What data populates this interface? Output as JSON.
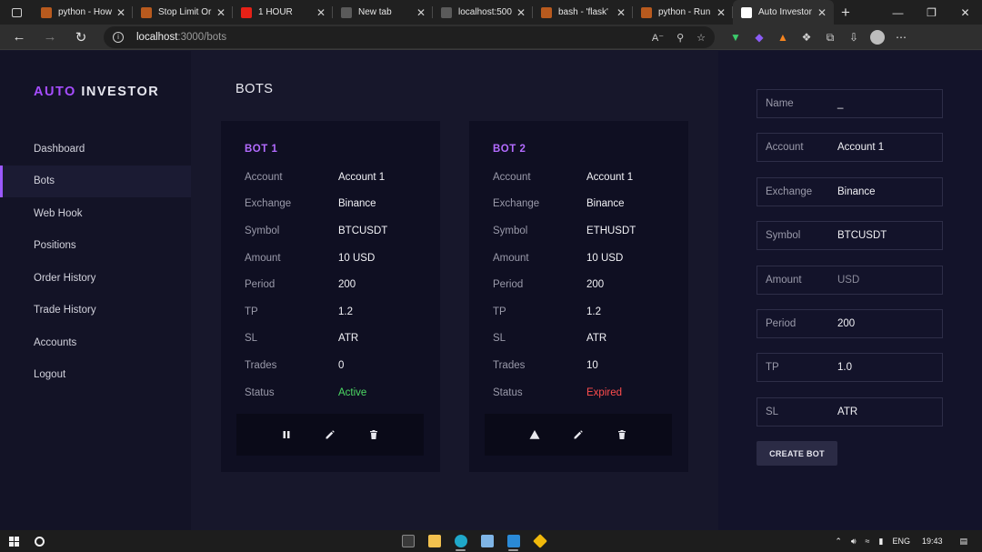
{
  "browser": {
    "tabs": [
      {
        "label": "python - How",
        "favicon_color": "#b85a1e",
        "active": false
      },
      {
        "label": "Stop Limit Or",
        "favicon_color": "#b85a1e",
        "active": false
      },
      {
        "label": "1 HOUR",
        "favicon_color": "#e62117",
        "active": false
      },
      {
        "label": "New tab",
        "favicon_color": "#5a5a5a",
        "active": false
      },
      {
        "label": "localhost:500",
        "favicon_color": "#5a5a5a",
        "active": false
      },
      {
        "label": "bash - 'flask'",
        "favicon_color": "#b85a1e",
        "active": false
      },
      {
        "label": "python - Run",
        "favicon_color": "#b85a1e",
        "active": false
      },
      {
        "label": "Auto Investor",
        "favicon_color": "#ffffff",
        "active": true
      }
    ],
    "url_host": "localhost",
    "url_path": ":3000/bots"
  },
  "app": {
    "logo_part1": "AUTO",
    "logo_part2": "INVESTOR",
    "nav": [
      {
        "label": "Dashboard",
        "active": false
      },
      {
        "label": "Bots",
        "active": true
      },
      {
        "label": "Web Hook",
        "active": false
      },
      {
        "label": "Positions",
        "active": false
      },
      {
        "label": "Order History",
        "active": false
      },
      {
        "label": "Trade History",
        "active": false
      },
      {
        "label": "Accounts",
        "active": false
      },
      {
        "label": "Logout",
        "active": false
      }
    ],
    "page_title": "BOTS",
    "bots": [
      {
        "title": "BOT 1",
        "rows": [
          {
            "key": "Account",
            "value": "Account 1"
          },
          {
            "key": "Exchange",
            "value": "Binance"
          },
          {
            "key": "Symbol",
            "value": "BTCUSDT"
          },
          {
            "key": "Amount",
            "value": "10 USD"
          },
          {
            "key": "Period",
            "value": "200"
          },
          {
            "key": "TP",
            "value": "1.2"
          },
          {
            "key": "SL",
            "value": "ATR"
          },
          {
            "key": "Trades",
            "value": "0"
          },
          {
            "key": "Status",
            "value": "Active"
          }
        ],
        "status_color": "#4cd964",
        "actions": [
          "pause-icon",
          "edit-icon",
          "delete-icon"
        ]
      },
      {
        "title": "BOT 2",
        "rows": [
          {
            "key": "Account",
            "value": "Account 1"
          },
          {
            "key": "Exchange",
            "value": "Binance"
          },
          {
            "key": "Symbol",
            "value": "ETHUSDT"
          },
          {
            "key": "Amount",
            "value": "10 USD"
          },
          {
            "key": "Period",
            "value": "200"
          },
          {
            "key": "TP",
            "value": "1.2"
          },
          {
            "key": "SL",
            "value": "ATR"
          },
          {
            "key": "Trades",
            "value": "10"
          },
          {
            "key": "Status",
            "value": "Expired"
          }
        ],
        "status_color": "#ff4d4d",
        "actions": [
          "warning-icon",
          "edit-icon",
          "delete-icon"
        ]
      }
    ],
    "form": {
      "fields": [
        {
          "label": "Name",
          "value": "_",
          "placeholder": false
        },
        {
          "label": "Account",
          "value": "Account 1",
          "placeholder": false
        },
        {
          "label": "Exchange",
          "value": "Binance",
          "placeholder": false
        },
        {
          "label": "Symbol",
          "value": "BTCUSDT",
          "placeholder": false
        },
        {
          "label": "Amount",
          "value": "USD",
          "placeholder": true
        },
        {
          "label": "Period",
          "value": "200",
          "placeholder": false
        },
        {
          "label": "TP",
          "value": "1.0",
          "placeholder": false
        },
        {
          "label": "SL",
          "value": "ATR",
          "placeholder": false
        }
      ],
      "submit_label": "CREATE BOT"
    }
  },
  "taskbar": {
    "language": "ENG",
    "time": "19:43"
  },
  "colors": {
    "accent": "#a64dff",
    "active_status": "#4cd964",
    "expired_status": "#ff4d4d"
  }
}
